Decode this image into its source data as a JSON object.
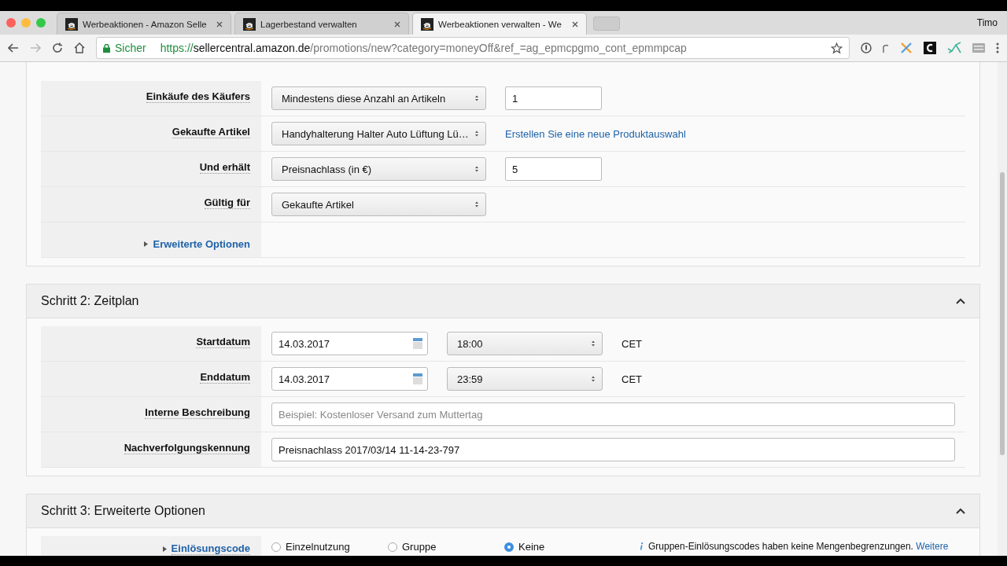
{
  "browser": {
    "tabs": [
      {
        "title": "Werbeaktionen - Amazon Selle",
        "selected": false
      },
      {
        "title": "Lagerbestand verwalten",
        "selected": false
      },
      {
        "title": "Werbeaktionen verwalten - We",
        "selected": true
      }
    ],
    "profile": "Timo",
    "security": "Sicher",
    "url_scheme": "https://",
    "url_host": "sellercentral.amazon.de",
    "url_path": "/promotions/new?category=moneyOff&ref_=ag_epmcpgmo_cont_epmmpcap"
  },
  "step1": {
    "rows": [
      {
        "kind": "select",
        "label": "Einkäufe des Käufers",
        "select": "Mindestens diese Anzahl an Artikeln",
        "input": "1"
      },
      {
        "kind": "select",
        "label": "Gekaufte Artikel",
        "select": "Handyhalterung Halter Auto Lüftung Lü…",
        "link": "Erstellen Sie eine neue Produktauswahl"
      },
      {
        "kind": "select",
        "label": "Und erhält",
        "select": "Preisnachlass (in €)",
        "input": "5"
      },
      {
        "kind": "select",
        "label": "Gültig für",
        "select": "Gekaufte Artikel"
      },
      {
        "kind": "expander",
        "label": "Erweiterte Optionen",
        "expanded": false
      }
    ]
  },
  "step2": {
    "title": "Schritt 2: Zeitplan",
    "expanded": true,
    "rows": [
      {
        "kind": "datetime",
        "label": "Startdatum",
        "date": "14.03.2017",
        "time": "18:00",
        "zone": "CET"
      },
      {
        "kind": "datetime",
        "label": "Enddatum",
        "date": "14.03.2017",
        "time": "23:59",
        "zone": "CET"
      },
      {
        "kind": "text",
        "label": "Interne Beschreibung",
        "placeholder": "Beispiel: Kostenloser Versand zum Muttertag"
      },
      {
        "kind": "text",
        "label": "Nachverfolgungskennung",
        "value": "Preisnachlass 2017/03/14 11-14-23-797"
      }
    ]
  },
  "step3": {
    "title": "Schritt 3: Erweiterte Optionen",
    "expanded": true,
    "label": "Einlösungscode",
    "options": [
      {
        "label": "Einzelnutzung",
        "selected": false
      },
      {
        "label": "Gruppe",
        "selected": false
      },
      {
        "label": "Keine",
        "selected": true
      }
    ],
    "info": "Gruppen-Einlösungscodes haben keine Mengenbegrenzungen.",
    "info_link": "Weitere"
  }
}
